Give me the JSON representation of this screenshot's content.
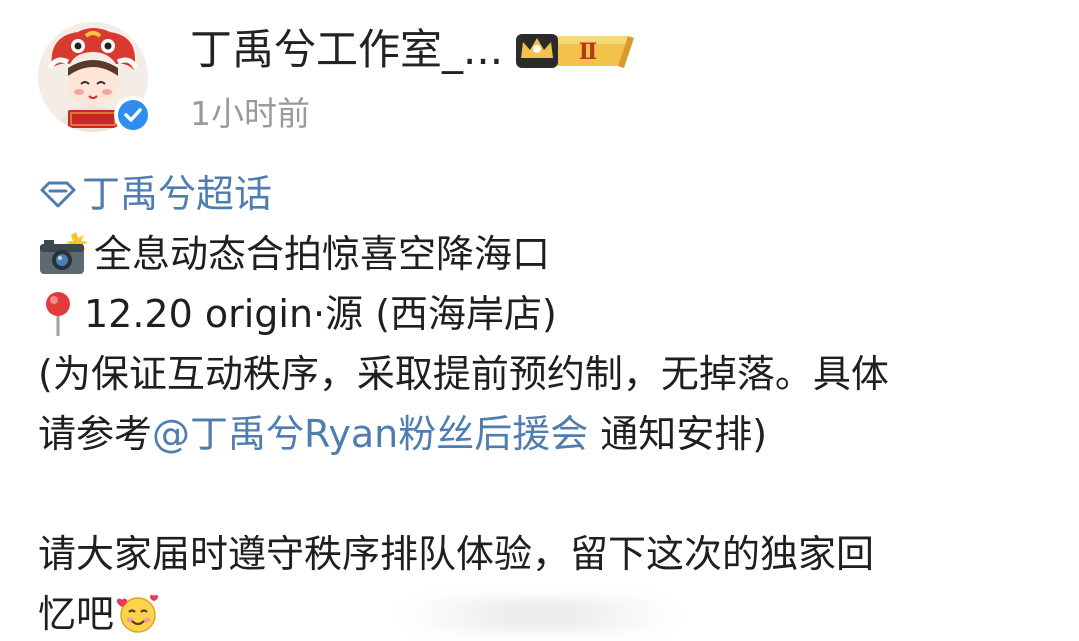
{
  "header": {
    "username": "丁禹兮工作室_...",
    "vip_level": "Ⅱ",
    "timestamp": "1小时前",
    "avatar_icon": "lion-dance-avatar",
    "verified_icon": "verified-badge-icon",
    "colors": {
      "verified_blue": "#2e8ef0",
      "vip_gold": "#f2c24a",
      "link_blue": "#507daf",
      "timestamp_gray": "#9a9a9a"
    }
  },
  "post": {
    "supertopic": "丁禹兮超话",
    "line1_icon": "camera-flash-icon",
    "line1_text": "全息动态合拍惊喜空降海口",
    "line2_icon": "round-pushpin-icon",
    "line2_text": "12.20 origin·源 (西海岸店)",
    "line3_text": "(为保证互动秩序，采取提前预约制，无掉落。具体",
    "line4_prefix": "请参考",
    "line4_mention": "@丁禹兮Ryan粉丝后援会",
    "line4_suffix": " 通知安排)",
    "line5_text": "请大家届时遵守秩序排队体验，留下这次的独家回",
    "line6_text": "忆吧",
    "line6_icon": "smiling-face-with-hearts-icon"
  }
}
